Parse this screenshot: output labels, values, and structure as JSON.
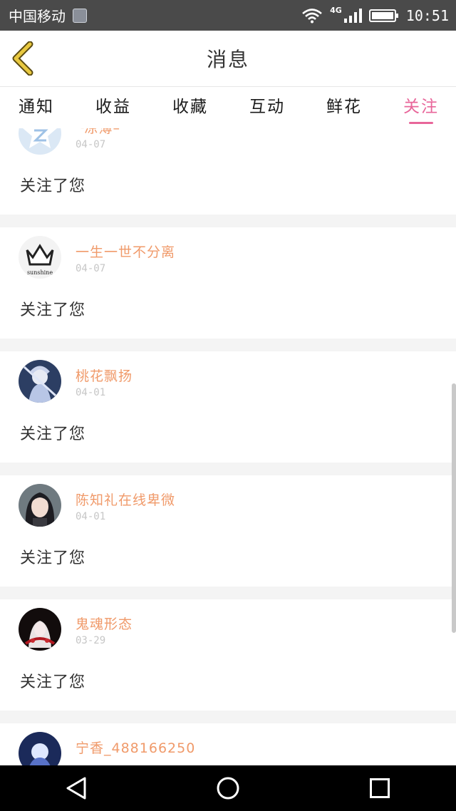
{
  "status_bar": {
    "carrier": "中国移动",
    "network": "4G",
    "time": "10:51"
  },
  "header": {
    "title": "消息"
  },
  "tabs": [
    {
      "label": "通知",
      "active": false
    },
    {
      "label": "收益",
      "active": false
    },
    {
      "label": "收藏",
      "active": false
    },
    {
      "label": "互动",
      "active": false
    },
    {
      "label": "鲜花",
      "active": false
    },
    {
      "label": "关注",
      "active": true
    }
  ],
  "notifications": [
    {
      "username": "╰凉薄–",
      "date": "04-07",
      "message": "关注了您",
      "avatar": "qq-star-avatar"
    },
    {
      "username": "一生一世不分离",
      "date": "04-07",
      "message": "关注了您",
      "avatar": "crown-sunshine-avatar"
    },
    {
      "username": "桃花飘扬",
      "date": "04-01",
      "message": "关注了您",
      "avatar": "anime-character-avatar"
    },
    {
      "username": "陈知礼在线卑微",
      "date": "04-01",
      "message": "关注了您",
      "avatar": "girl-photo-avatar"
    },
    {
      "username": "鬼魂形态",
      "date": "03-29",
      "message": "关注了您",
      "avatar": "dark-anime-avatar"
    },
    {
      "username": "宁香_488166250",
      "date": "",
      "message": "",
      "avatar": "blue-anime-avatar"
    }
  ],
  "avatar_text": {
    "crown_caption": "sunshine"
  },
  "colors": {
    "accent": "#e8669a",
    "username": "#f09a6a",
    "status_bar": "#4a4a4a",
    "back_arrow": "#e8c840"
  }
}
